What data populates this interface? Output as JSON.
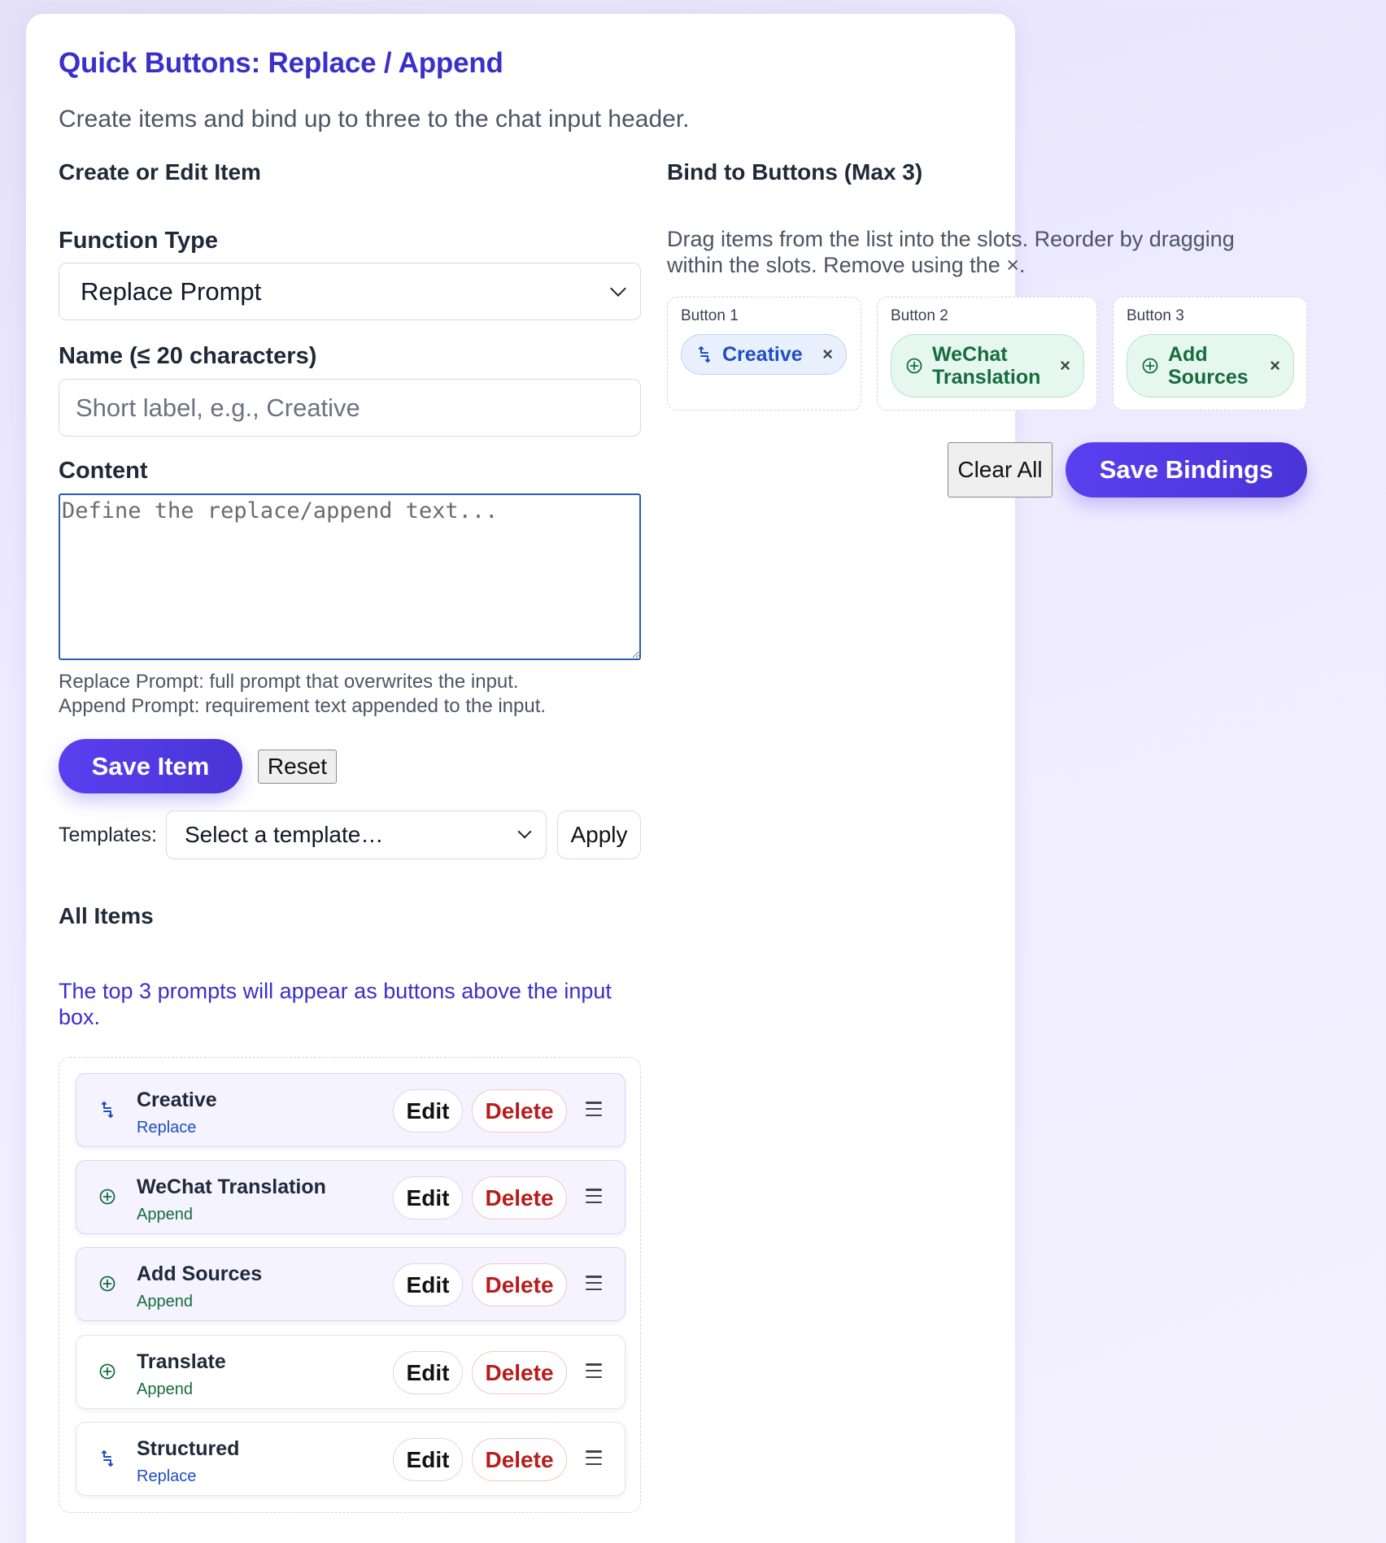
{
  "header": {
    "title": "Quick Buttons: Replace / Append",
    "subtitle": "Create items and bind up to three to the chat input header."
  },
  "editor": {
    "section_title": "Create or Edit Item",
    "function_type_label": "Function Type",
    "function_type_value": "Replace Prompt",
    "name_label": "Name (≤ 20 characters)",
    "name_placeholder": "Short label, e.g., Creative",
    "content_label": "Content",
    "content_placeholder": "Define the replace/append text...",
    "hint_line1": "Replace Prompt: full prompt that overwrites the input.",
    "hint_line2": "Append Prompt: requirement text appended to the input.",
    "save_label": "Save Item",
    "reset_label": "Reset",
    "templates_label": "Templates:",
    "templates_value": "Select a template…",
    "apply_label": "Apply"
  },
  "items": {
    "section_title": "All Items",
    "note": "The top 3 prompts will appear as buttons above the input box.",
    "edit_label": "Edit",
    "delete_label": "Delete",
    "list": [
      {
        "name": "Creative",
        "type": "Replace",
        "icon": "swap-arrows-icon"
      },
      {
        "name": "WeChat Translation",
        "type": "Append",
        "icon": "plus-circle-icon"
      },
      {
        "name": "Add Sources",
        "type": "Append",
        "icon": "plus-circle-icon"
      },
      {
        "name": "Translate",
        "type": "Append",
        "icon": "plus-circle-icon"
      },
      {
        "name": "Structured",
        "type": "Replace",
        "icon": "swap-arrows-icon"
      }
    ]
  },
  "bindings": {
    "section_title": "Bind to Buttons (Max 3)",
    "description": "Drag items from the list into the slots. Reorder by dragging within the slots. Remove using the ×.",
    "slots": [
      {
        "label": "Button 1",
        "chip": "Creative",
        "type": "Replace"
      },
      {
        "label": "Button 2",
        "chip": "WeChat Translation",
        "type": "Append"
      },
      {
        "label": "Button 3",
        "chip": "Add Sources",
        "type": "Append"
      }
    ],
    "remove_glyph": "×",
    "clear_label": "Clear All",
    "save_label": "Save Bindings"
  },
  "colors": {
    "accent": "#5a3ff0",
    "title": "#3b2fc9",
    "replace": "#1f4fc0",
    "append": "#176c3f",
    "danger": "#b91c1c"
  }
}
